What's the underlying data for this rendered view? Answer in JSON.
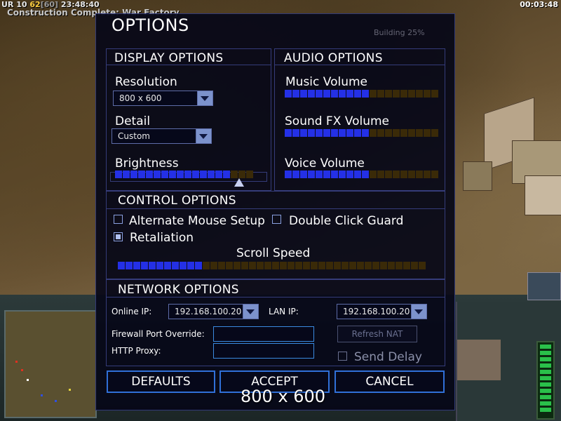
{
  "hud": {
    "stat_prefix": "UR 10",
    "stat_yellow": "62",
    "stat_gray": "[60]",
    "stat_time": "23:48:40",
    "message": "Construction Complete: War Factory",
    "clock": "00:03:48",
    "building_status": "Building 25%"
  },
  "dialog": {
    "title": "OPTIONS",
    "display": {
      "heading": "DISPLAY OPTIONS",
      "resolution_label": "Resolution",
      "resolution_value": "800 x 600",
      "detail_label": "Detail",
      "detail_value": "Custom",
      "brightness_label": "Brightness",
      "brightness_level": 0.833
    },
    "audio": {
      "heading": "AUDIO OPTIONS",
      "music_label": "Music Volume",
      "music_level": 0.55,
      "sfx_label": "Sound FX Volume",
      "sfx_level": 0.55,
      "voice_label": "Voice Volume",
      "voice_level": 0.55
    },
    "control": {
      "heading": "CONTROL OPTIONS",
      "alt_mouse_label": "Alternate Mouse Setup",
      "alt_mouse_checked": false,
      "double_click_label": "Double Click Guard",
      "double_click_checked": false,
      "retaliation_label": "Retaliation",
      "retaliation_checked": true,
      "scroll_label": "Scroll Speed",
      "scroll_level": 0.27
    },
    "network": {
      "heading": "NETWORK OPTIONS",
      "online_ip_label": "Online IP:",
      "online_ip_value": "192.168.100.20",
      "lan_ip_label": "LAN IP:",
      "lan_ip_value": "192.168.100.20",
      "firewall_label": "Firewall Port Override:",
      "firewall_value": "",
      "proxy_label": "HTTP Proxy:",
      "proxy_value": "",
      "refresh_nat_label": "Refresh NAT",
      "send_delay_label": "Send Delay",
      "send_delay_checked": false
    },
    "buttons": {
      "defaults": "DEFAULTS",
      "accept": "ACCEPT",
      "cancel": "CANCEL"
    },
    "version_overlay": "800 x 600"
  },
  "colors": {
    "slider_on": "#2430e6",
    "slider_off": "#3a2a08",
    "button_border": "#3070d8",
    "panel_border": "#353c7a"
  }
}
